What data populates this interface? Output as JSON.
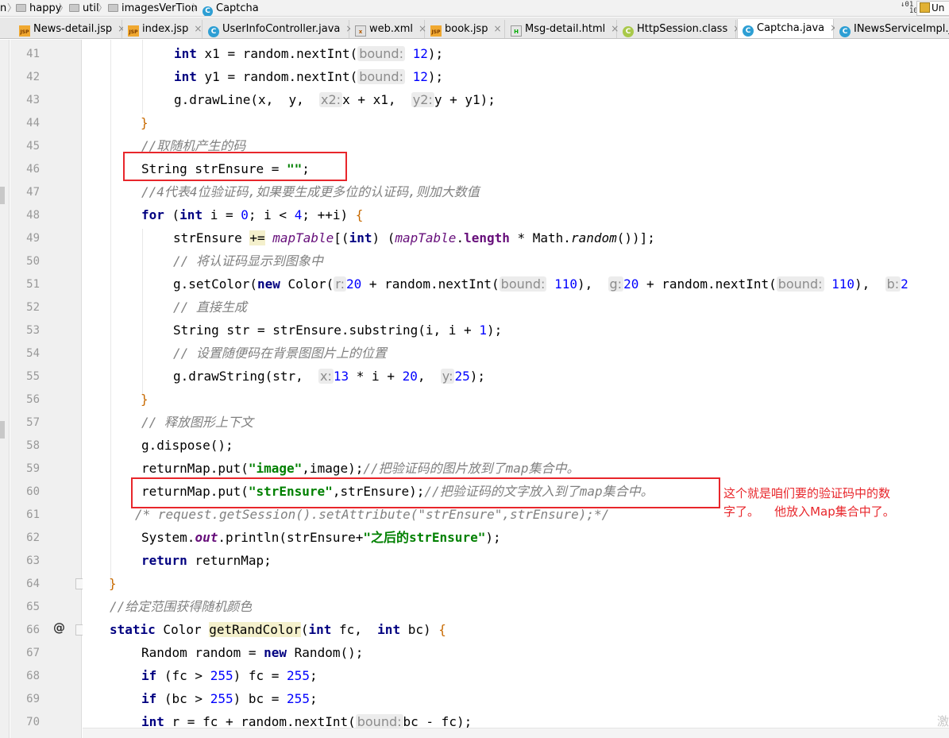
{
  "breadcrumb": {
    "items": [
      {
        "label": "n",
        "icon": "none"
      },
      {
        "label": "happy",
        "icon": "folder-icon"
      },
      {
        "label": "util",
        "icon": "folder-icon"
      },
      {
        "label": "imagesVerTion",
        "icon": "folder-icon"
      },
      {
        "label": "Captcha",
        "icon": "class-icon"
      }
    ],
    "separator": "〉",
    "right_button": "Un"
  },
  "tabs": [
    {
      "label": "News-detail.jsp",
      "type": "jsp",
      "active": false
    },
    {
      "label": "index.jsp",
      "type": "jsp",
      "active": false
    },
    {
      "label": "UserInfoController.java",
      "type": "java",
      "active": false
    },
    {
      "label": "web.xml",
      "type": "xml",
      "active": false
    },
    {
      "label": "book.jsp",
      "type": "jsp",
      "active": false
    },
    {
      "label": "Msg-detail.html",
      "type": "html",
      "active": false
    },
    {
      "label": "HttpSession.class",
      "type": "class",
      "active": false
    },
    {
      "label": "Captcha.java",
      "type": "java",
      "active": true
    },
    {
      "label": "INewsServiceImpl.java",
      "type": "java",
      "active": false
    }
  ],
  "tab_close_glyph": "×",
  "icon_glyphs": {
    "class": "C",
    "jsp": "JSP",
    "xml": "x",
    "html": "H"
  },
  "line_numbers": [
    "41",
    "42",
    "43",
    "44",
    "45",
    "46",
    "47",
    "48",
    "49",
    "50",
    "51",
    "52",
    "53",
    "54",
    "55",
    "56",
    "57",
    "58",
    "59",
    "60",
    "61",
    "62",
    "63",
    "64",
    "65",
    "66",
    "67",
    "68",
    "69",
    "70"
  ],
  "code": {
    "l41": {
      "kw": "int",
      "a": "x1 = random.nextInt(",
      "ph": "bound:",
      "n": "12",
      "b": ");"
    },
    "l42": {
      "kw": "int",
      "a": "y1 = random.nextInt(",
      "ph": "bound:",
      "n": "12",
      "b": ");"
    },
    "l43": {
      "a": "g.drawLine(x,  y,  ",
      "ph1": "x2:",
      "b": "x + x1,  ",
      "ph2": "y2:",
      "c": "y + y1);"
    },
    "l44": "}",
    "l45": "//取随机产生的码",
    "l46": {
      "a": "String strEnsure = ",
      "s": "\"\"",
      "b": ";"
    },
    "l47": "//4代表4位验证码,如果要生成更多位的认证码,则加大数值",
    "l48": {
      "kw1": "for",
      "a": " (",
      "kw2": "int",
      "b": " i = ",
      "n1": "0",
      "c": "; i < ",
      "n2": "4",
      "d": "; ++i) ",
      "br": "{"
    },
    "l49": {
      "a": "strEnsure ",
      "op": "+=",
      "b": " ",
      "f1": "mapTable",
      "c": "[(",
      "kw": "int",
      "d": ") (",
      "f2": "mapTable",
      "e": ".",
      "f3": "length",
      "g": " * Math.",
      "st": "random",
      "h": "())];"
    },
    "l50": "// 将认证码显示到图象中",
    "l51": {
      "a": "g.setColor(",
      "kw": "new",
      "b": " Color(",
      "ph1": "r:",
      "n1": "20",
      "c": " + random.nextInt(",
      "ph2": "bound:",
      "n2": "110",
      "d": "),  ",
      "ph3": "g:",
      "n3": "20",
      "e": " + random.nextInt(",
      "ph4": "bound:",
      "n4": "110",
      "f": "),  ",
      "ph5": "b:",
      "n5": "2"
    },
    "l52": "// 直接生成",
    "l53": {
      "a": "String str = strEnsure.substring(i, i + ",
      "n": "1",
      "b": ");"
    },
    "l54": "// 设置随便码在背景图图片上的位置",
    "l55": {
      "a": "g.drawString(str,  ",
      "ph1": "x:",
      "n1": "13",
      "b": " * i + ",
      "n2": "20",
      "c": ",  ",
      "ph2": "y:",
      "n3": "25",
      "d": ");"
    },
    "l56": "}",
    "l57": "// 释放图形上下文",
    "l58": "g.dispose();",
    "l59": {
      "a": "returnMap.put(",
      "s": "\"image\"",
      "b": ",image);",
      "cm": "//把验证码的图片放到了map集合中。"
    },
    "l60": {
      "a": "returnMap.put(",
      "s": "\"strEnsure\"",
      "b": ",strEnsure);",
      "cm": "//把验证码的文字放入到了map集合中。"
    },
    "l61": "/* request.getSession().setAttribute(\"strEnsure\",strEnsure);*/",
    "l62": {
      "a": "System.",
      "out": "out",
      "b": ".println(strEnsure+",
      "s": "\"之后的strEnsure\"",
      "c": ");"
    },
    "l63": {
      "kw": "return",
      "a": " returnMap;"
    },
    "l64": "}",
    "l65": "//给定范围获得随机颜色",
    "l66": {
      "kw1": "static",
      "a": " Color ",
      "fn": "getRandColor",
      "b": "(",
      "kw2": "int",
      "c": " fc,  ",
      "kw3": "int",
      "d": " bc) ",
      "br": "{"
    },
    "l67": {
      "a": "Random random = ",
      "kw": "new",
      "b": " Random();"
    },
    "l68": {
      "kw": "if",
      "a": " (fc > ",
      "n1": "255",
      "b": ") fc = ",
      "n2": "255",
      "c": ";"
    },
    "l69": {
      "kw": "if",
      "a": " (bc > ",
      "n1": "255",
      "b": ") bc = ",
      "n2": "255",
      "c": ";"
    },
    "l70": {
      "kw": "int",
      "a": " r = fc + random.nextInt(",
      "ph": "bound:",
      "b": "bc - fc);"
    }
  },
  "annotation": "这个就是咱们要的验证码中的数\n字了。    他放入Map集合中了。",
  "gutter_at_symbol": "@",
  "watermark": "激",
  "colors": {
    "keyword": "#000080",
    "number": "#0000ff",
    "string": "#008000",
    "comment": "#808080",
    "field": "#660e7a",
    "annotation_red": "#e8262b"
  }
}
